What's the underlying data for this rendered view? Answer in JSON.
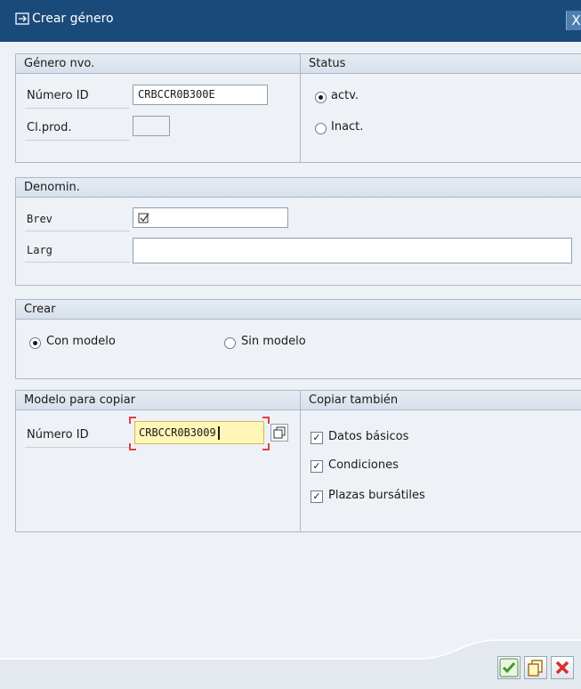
{
  "window": {
    "title": "Crear género",
    "close_label": "X"
  },
  "genero_nvo": {
    "header": "Género nvo.",
    "numero_id_label": "Número ID",
    "numero_id_value": "CRBCCR0B300E",
    "clprod_label": "Cl.prod.",
    "clprod_value": ""
  },
  "status": {
    "header": "Status",
    "options": [
      {
        "label": "actv.",
        "selected": true
      },
      {
        "label": "Inact.",
        "selected": false
      }
    ]
  },
  "denomin": {
    "header": "Denomin.",
    "brev_label": "Brev",
    "brev_value": "",
    "larg_label": "Larg",
    "larg_value": ""
  },
  "crear": {
    "header": "Crear",
    "options": [
      {
        "label": "Con modelo",
        "selected": true
      },
      {
        "label": "Sin modelo",
        "selected": false
      }
    ]
  },
  "modelo": {
    "header": "Modelo para copiar",
    "numero_id_label": "Número ID",
    "numero_id_value": "CRBCCR0B3009"
  },
  "copiar": {
    "header": "Copiar también",
    "options": [
      {
        "label": "Datos básicos",
        "checked": true
      },
      {
        "label": "Condiciones",
        "checked": true
      },
      {
        "label": "Plazas bursátiles",
        "checked": true
      }
    ]
  },
  "colors": {
    "titlebar": "#1a4a7a",
    "focus_field": "#fff6b7",
    "cancel": "#d9302c",
    "confirm": "#3c9a2a"
  },
  "icons": [
    "create-window-icon",
    "close-icon",
    "checkbox-list-icon",
    "copy-value-icon",
    "confirm-icon",
    "copy-icon",
    "cancel-icon"
  ]
}
